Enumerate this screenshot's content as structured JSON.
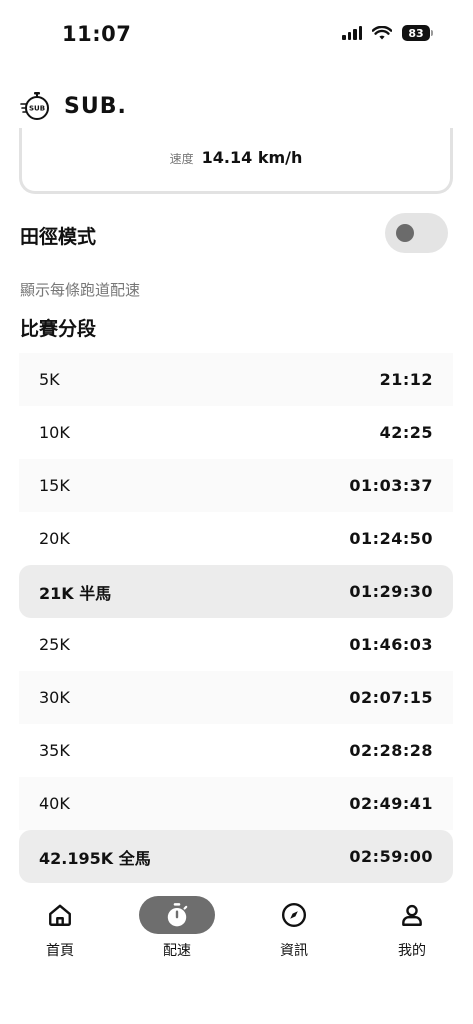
{
  "status_bar": {
    "time": "11:07",
    "battery": "83",
    "icons": [
      "signal-icon",
      "wifi-icon",
      "battery-icon"
    ]
  },
  "header": {
    "logo_icon": "stopwatch-sub-icon",
    "logo_text": "SUB",
    "title": "SUB."
  },
  "pace_card": {
    "speed_label": "速度",
    "speed_value": "14.14 km/h"
  },
  "track_mode": {
    "label": "田徑模式",
    "enabled": false,
    "description": "顯示每條跑道配速"
  },
  "splits": {
    "title": "比賽分段",
    "rows": [
      {
        "distance": "5K",
        "time": "21:12",
        "highlight": false
      },
      {
        "distance": "10K",
        "time": "42:25",
        "highlight": false
      },
      {
        "distance": "15K",
        "time": "01:03:37",
        "highlight": false
      },
      {
        "distance": "20K",
        "time": "01:24:50",
        "highlight": false
      },
      {
        "distance": "21K 半馬",
        "time": "01:29:30",
        "highlight": true
      },
      {
        "distance": "25K",
        "time": "01:46:03",
        "highlight": false
      },
      {
        "distance": "30K",
        "time": "02:07:15",
        "highlight": false
      },
      {
        "distance": "35K",
        "time": "02:28:28",
        "highlight": false
      },
      {
        "distance": "40K",
        "time": "02:49:41",
        "highlight": false
      },
      {
        "distance": "42.195K 全馬",
        "time": "02:59:00",
        "highlight": true
      }
    ]
  },
  "bottom_nav": {
    "items": [
      {
        "label": "首頁",
        "icon": "home-icon",
        "active": false
      },
      {
        "label": "配速",
        "icon": "stopwatch-icon",
        "active": true
      },
      {
        "label": "資訊",
        "icon": "compass-icon",
        "active": false
      },
      {
        "label": "我的",
        "icon": "user-icon",
        "active": false
      }
    ]
  },
  "colors": {
    "accent": "#6e6e6e",
    "row_alt": "#fafafa",
    "highlight_row": "#ececec",
    "toggle_track": "#e4e4e4"
  }
}
